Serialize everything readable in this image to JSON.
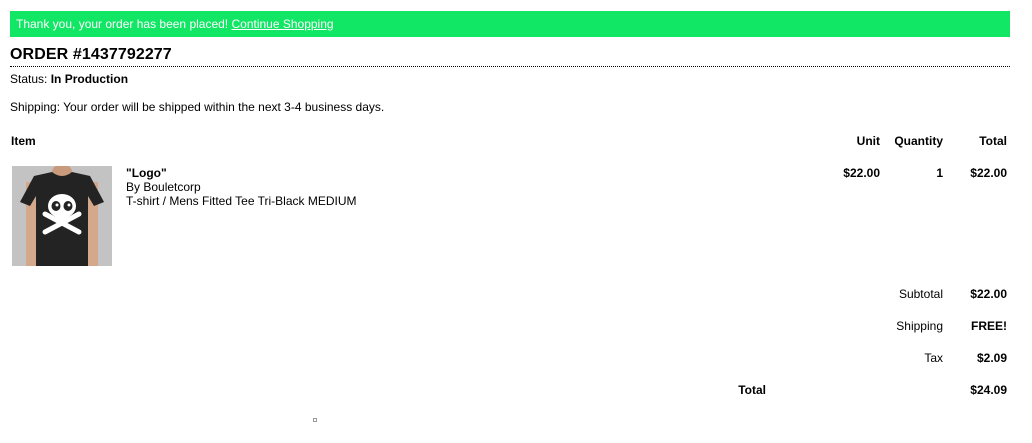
{
  "banner": {
    "message": "Thank you, your order has been placed!",
    "link_label": "Continue Shopping"
  },
  "order": {
    "title": "ORDER #1437792277",
    "status_label": "Status:",
    "status_value": "In Production",
    "shipping_note": "Shipping: Your order will be shipped within the next 3-4 business days."
  },
  "table": {
    "headers": {
      "item": "Item",
      "unit": "Unit",
      "quantity": "Quantity",
      "total": "Total"
    },
    "rows": [
      {
        "name": "\"Logo\"",
        "by": "By Bouletcorp",
        "description": "T-shirt / Mens Fitted Tee Tri-Black MEDIUM",
        "unit": "$22.00",
        "quantity": "1",
        "total": "$22.00",
        "image_icon": "skull-crossbones-tshirt"
      }
    ]
  },
  "summary": {
    "subtotal_label": "Subtotal",
    "subtotal_value": "$22.00",
    "shipping_label": "Shipping",
    "shipping_value": "FREE!",
    "tax_label": "Tax",
    "tax_value": "$2.09",
    "total_label": "Total",
    "total_value": "$24.09"
  },
  "colors": {
    "banner_bg": "#11e765",
    "banner_text": "#ffffff"
  }
}
